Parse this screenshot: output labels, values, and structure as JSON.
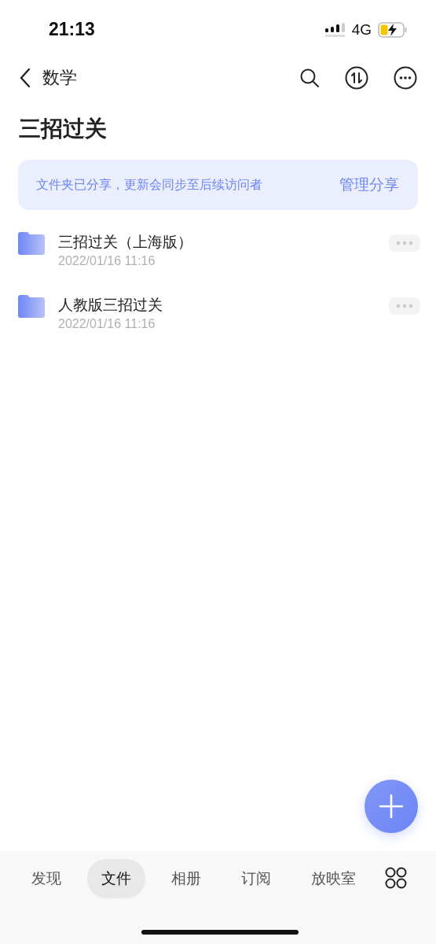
{
  "status_bar": {
    "time": "21:13",
    "network": "4G"
  },
  "nav": {
    "title": "数学"
  },
  "folder_title": "三招过关",
  "share_banner": {
    "message": "文件夹已分享，更新会同步至后续访问者",
    "action": "管理分享"
  },
  "files": [
    {
      "name": "三招过关（上海版）",
      "date": "2022/01/16 11:16"
    },
    {
      "name": "人教版三招过关",
      "date": "2022/01/16 11:16"
    }
  ],
  "tabs": [
    {
      "label": "发现",
      "selected": false
    },
    {
      "label": "文件",
      "selected": true
    },
    {
      "label": "相册",
      "selected": false
    },
    {
      "label": "订阅",
      "selected": false
    },
    {
      "label": "放映室",
      "selected": false
    }
  ]
}
